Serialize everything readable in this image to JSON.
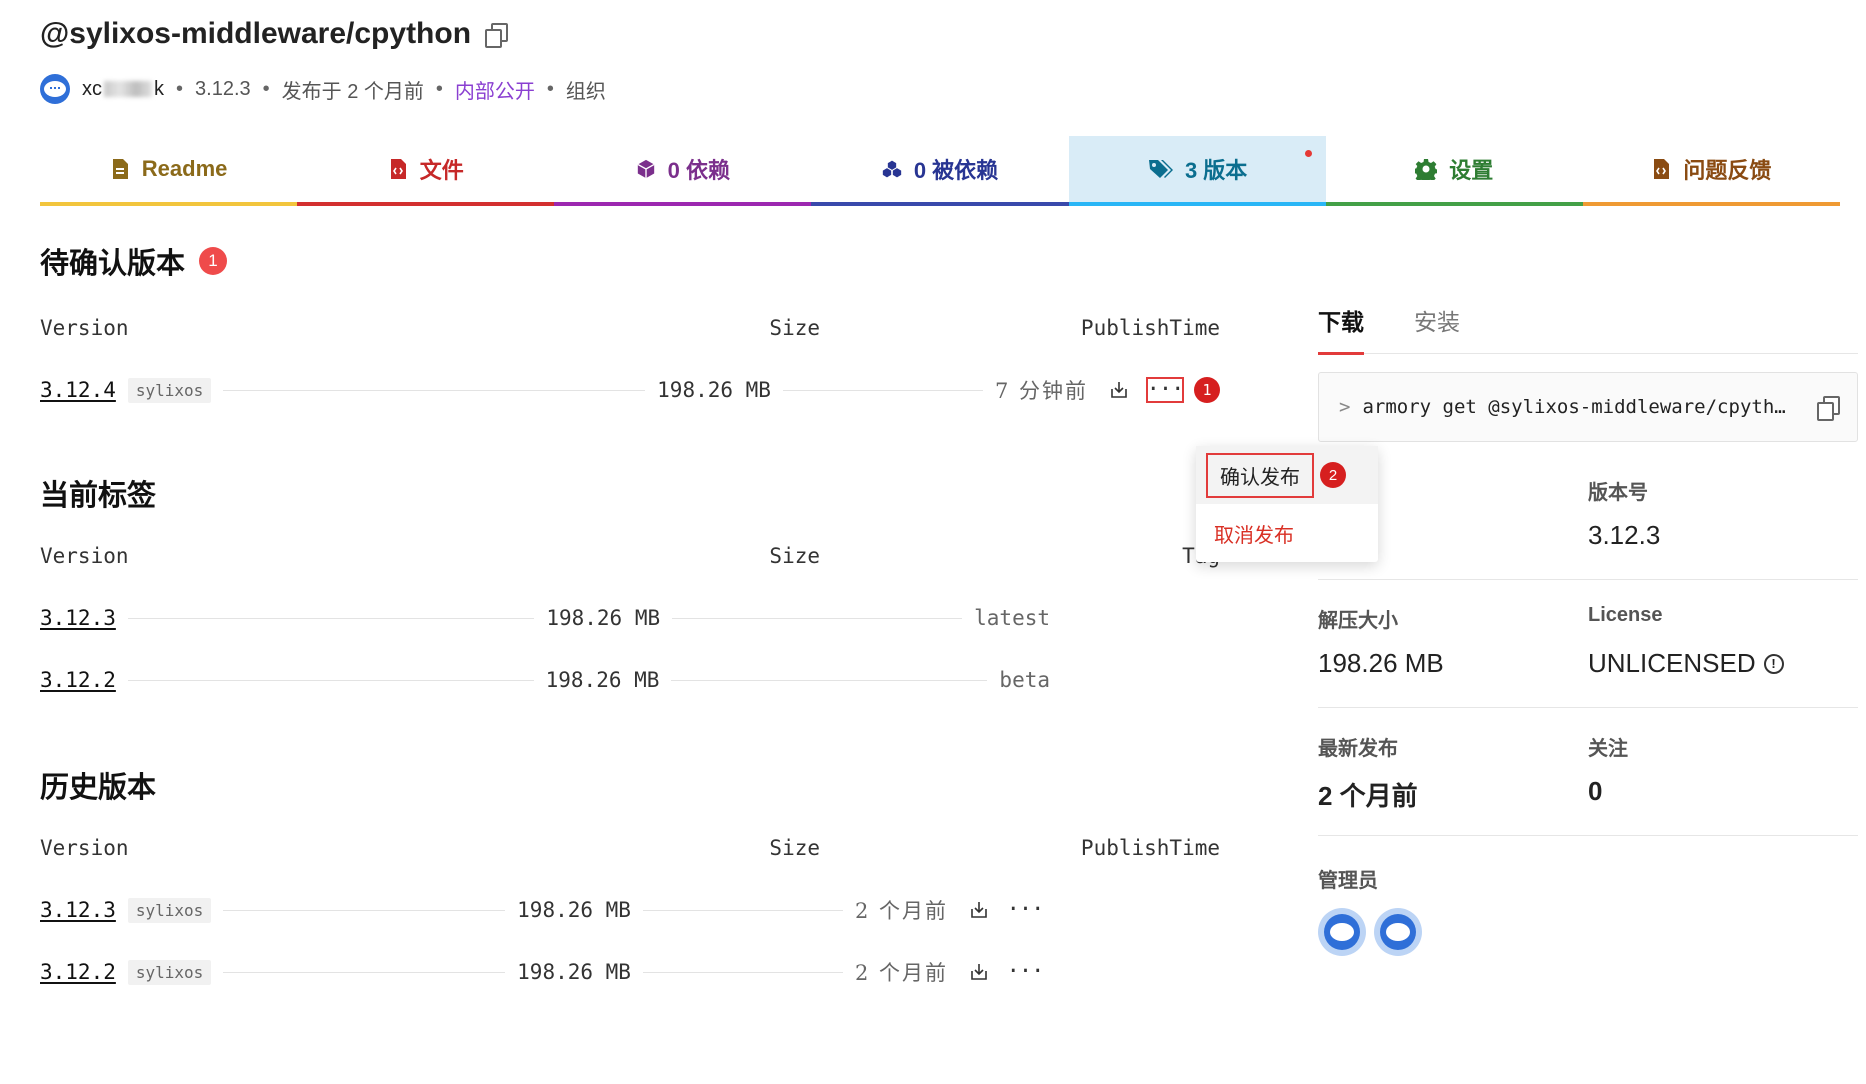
{
  "header": {
    "title": "@sylixos-middleware/cpython",
    "user_prefix": "xc",
    "user_suffix": "k",
    "version": "3.12.3",
    "published": "发布于 2 个月前",
    "visibility": "内部公开",
    "owner_type": "组织",
    "separator": "•"
  },
  "tabs": [
    {
      "label": "Readme",
      "icon": "readme-doc-icon",
      "color": "#8b6a1a",
      "underline": "#f2c53d"
    },
    {
      "label": "文件",
      "icon": "file-code-icon",
      "color": "#c62828",
      "underline": "#d32f2f"
    },
    {
      "label": "0 依赖",
      "icon": "box-icon",
      "color": "#7b2f8c",
      "underline": "#9c27b0"
    },
    {
      "label": "0 被依赖",
      "icon": "boxes-icon",
      "color": "#283593",
      "underline": "#3949ab"
    },
    {
      "label": "3 版本",
      "icon": "tags-icon",
      "color": "#0b6e8f",
      "underline": "#29b6f6",
      "active": true
    },
    {
      "label": "设置",
      "icon": "gear-icon",
      "color": "#2e7d32",
      "underline": "#43a047"
    },
    {
      "label": "问题反馈",
      "icon": "file-code-icon",
      "color": "#8a4b12",
      "underline": "#ef9a33"
    }
  ],
  "pending": {
    "title": "待确认版本",
    "count": "1",
    "headers": {
      "version": "Version",
      "size": "Size",
      "time": "PublishTime"
    },
    "rows": [
      {
        "version": "3.12.4",
        "os": "sylixos",
        "size": "198.26 MB",
        "time": "7 分钟前",
        "more": "···",
        "mark": "1"
      }
    ]
  },
  "dropdown": {
    "confirm": "确认发布",
    "cancel": "取消发布",
    "mark": "2"
  },
  "current": {
    "title": "当前标签",
    "headers": {
      "version": "Version",
      "size": "Size",
      "tag": "Tag"
    },
    "rows": [
      {
        "version": "3.12.3",
        "size": "198.26 MB",
        "tag": "latest"
      },
      {
        "version": "3.12.2",
        "size": "198.26 MB",
        "tag": "beta"
      }
    ]
  },
  "history": {
    "title": "历史版本",
    "headers": {
      "version": "Version",
      "size": "Size",
      "time": "PublishTime"
    },
    "rows": [
      {
        "version": "3.12.3",
        "os": "sylixos",
        "size": "198.26 MB",
        "time": "2 个月前",
        "more": "···"
      },
      {
        "version": "3.12.2",
        "os": "sylixos",
        "size": "198.26 MB",
        "time": "2 个月前",
        "more": "···"
      }
    ]
  },
  "sidebar": {
    "tabs": [
      "下载",
      "安装"
    ],
    "command_prompt": ">",
    "command": "armory get @sylixos-middleware/cpyth…",
    "info": [
      {
        "label": "",
        "value": ""
      },
      {
        "label": "版本号",
        "value": "3.12.3"
      },
      {
        "label": "解压大小",
        "value": "198.26 MB"
      },
      {
        "label": "License",
        "value": "UNLICENSED",
        "icon": "info-circle-icon",
        "icon_glyph": "!"
      },
      {
        "label": "最新发布",
        "value": "2 个月前"
      },
      {
        "label": "关注",
        "value": "0"
      }
    ],
    "admins_label": "管理员"
  }
}
